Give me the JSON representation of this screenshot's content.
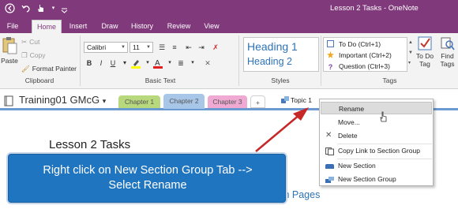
{
  "titlebar": {
    "title": "Lesson 2 Tasks  -  OneNote",
    "background": "#80397b"
  },
  "ribbon_tabs": [
    {
      "label": "File",
      "active": false
    },
    {
      "label": "Home",
      "active": true
    },
    {
      "label": "Insert",
      "active": false
    },
    {
      "label": "Draw",
      "active": false
    },
    {
      "label": "History",
      "active": false
    },
    {
      "label": "Review",
      "active": false
    },
    {
      "label": "View",
      "active": false
    }
  ],
  "clipboard": {
    "paste": "Paste",
    "cut": "Cut",
    "copy": "Copy",
    "format_painter": "Format Painter",
    "group_label": "Clipboard"
  },
  "basic_text": {
    "font_name": "Calibri",
    "font_size": "11",
    "group_label": "Basic Text",
    "bold": "B",
    "italic": "I",
    "underline": "U"
  },
  "styles": {
    "heading1": "Heading 1",
    "heading2": "Heading 2",
    "group_label": "Styles"
  },
  "tags": {
    "items": [
      {
        "label": "To Do (Ctrl+1)",
        "icon": "checkbox-icon"
      },
      {
        "label": "Important (Ctrl+2)",
        "icon": "star-icon"
      },
      {
        "label": "Question (Ctrl+3)",
        "icon": "question-icon"
      }
    ],
    "todo_tag": "To Do Tag",
    "find_tags": "Find Tags",
    "group_label": "Tags"
  },
  "notebook": {
    "name": "Training01 GMcG",
    "sections": [
      {
        "label": "Chapter 1",
        "color": "#b7d87c"
      },
      {
        "label": "Chapter 2",
        "color": "#a8c7e8"
      },
      {
        "label": "Chapter 3",
        "color": "#efa9d3"
      }
    ],
    "add_tab": "+",
    "section_group": "Topic 1"
  },
  "page": {
    "title": "Lesson 2 Tasks",
    "visible_text_fragment": "th Pages"
  },
  "callout": {
    "line1": "Right click on New Section Group Tab -->",
    "line2": "Select Rename"
  },
  "context_menu": {
    "items": [
      {
        "label": "Rename",
        "highlighted": true
      },
      {
        "label": "Move...",
        "highlighted": false
      },
      {
        "label": "Delete",
        "highlighted": false
      },
      {
        "label": "Copy Link to Section Group",
        "highlighted": false
      },
      {
        "label": "New Section",
        "highlighted": false
      },
      {
        "label": "New Section Group",
        "highlighted": false
      }
    ]
  }
}
